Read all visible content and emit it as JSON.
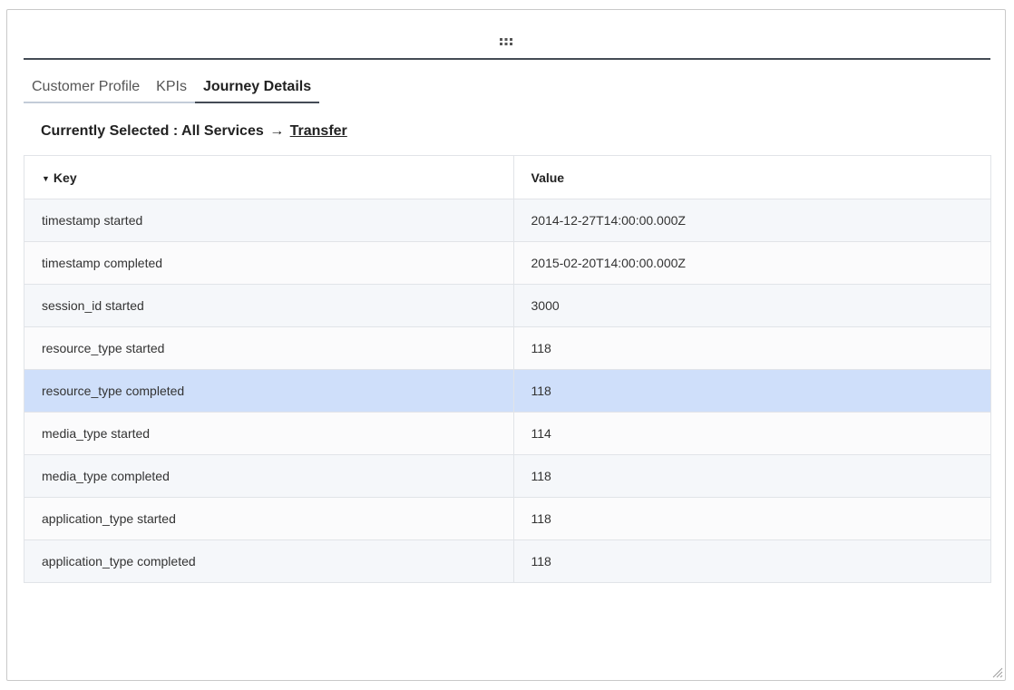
{
  "tabs": [
    {
      "label": "Customer Profile",
      "active": false
    },
    {
      "label": "KPIs",
      "active": false
    },
    {
      "label": "Journey Details",
      "active": true
    }
  ],
  "selection": {
    "prefix": "Currently Selected : All Services",
    "arrow": "→",
    "link": "Transfer"
  },
  "table": {
    "sort_indicator": "▼",
    "columns": [
      "Key",
      "Value"
    ],
    "rows": [
      {
        "key": "timestamp started",
        "value": "2014-12-27T14:00:00.000Z"
      },
      {
        "key": "timestamp completed",
        "value": "2015-02-20T14:00:00.000Z"
      },
      {
        "key": "session_id started",
        "value": "3000"
      },
      {
        "key": "resource_type started",
        "value": "118"
      },
      {
        "key": "resource_type completed",
        "value": "118",
        "selected": true
      },
      {
        "key": "media_type started",
        "value": "114"
      },
      {
        "key": "media_type completed",
        "value": "118"
      },
      {
        "key": "application_type started",
        "value": "118"
      },
      {
        "key": "application_type completed",
        "value": "118"
      }
    ]
  },
  "icons": {
    "drag": "drag-handle-icon",
    "resize": "resize-grip-icon",
    "sort": "sort-down-icon"
  },
  "colors": {
    "accent": "#444b55",
    "selected_row": "#cfdffa"
  }
}
